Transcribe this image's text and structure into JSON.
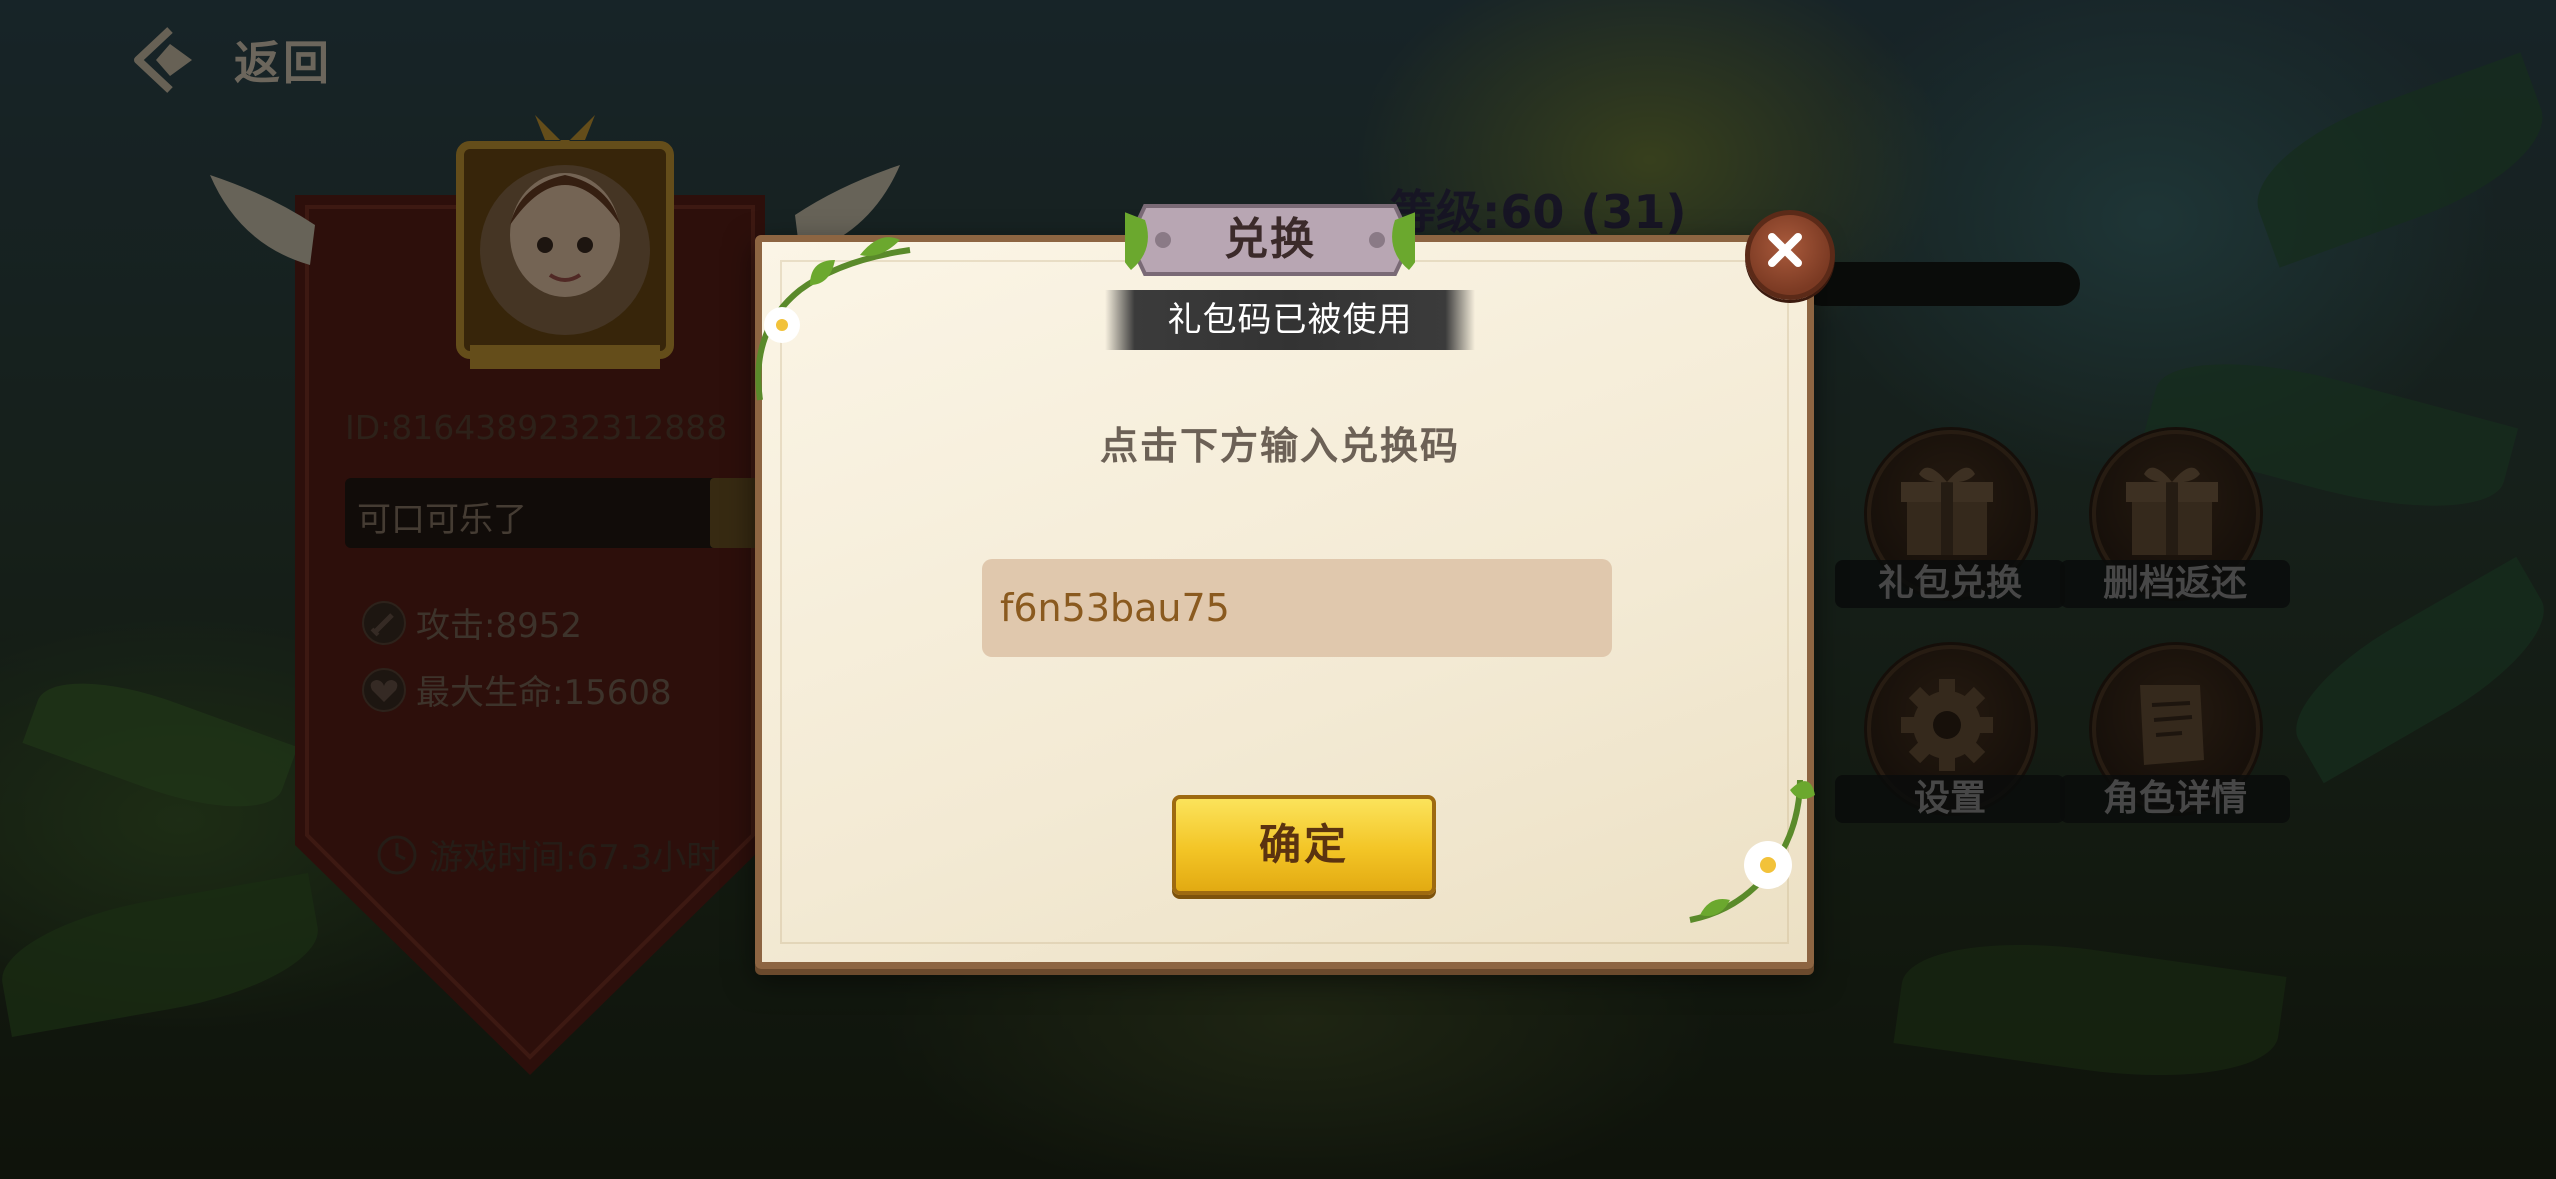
{
  "header": {
    "back_label": "返回"
  },
  "profile": {
    "id_text": "ID:8164389232312888",
    "name": "可口可乐了",
    "attack": "攻击:8952",
    "max_hp": "最大生命:15608",
    "playtime": "游戏时间:67.3小时"
  },
  "level": {
    "text": "等级:60 (31)"
  },
  "menu": {
    "gift_redeem": "礼包兑换",
    "delete_refund": "删档返还",
    "settings": "设置",
    "role_details": "角色详情"
  },
  "dialog": {
    "title": "兑换",
    "status_message": "礼包码已被使用",
    "prompt": "点击下方输入兑换码",
    "code_value": "f6n53bau75",
    "confirm_label": "确定"
  },
  "icons": {
    "back": "back-arrow-icon",
    "close": "close-icon",
    "attack": "sword-icon",
    "hp": "heart-icon",
    "time": "clock-icon",
    "gift": "gift-icon",
    "settings": "gear-icon",
    "scroll": "scroll-icon"
  },
  "colors": {
    "confirm_button": "#f3c526",
    "dialog_paper": "#f3ead4",
    "input_background": "#e0c8ad",
    "close_button": "#7b3a23"
  }
}
